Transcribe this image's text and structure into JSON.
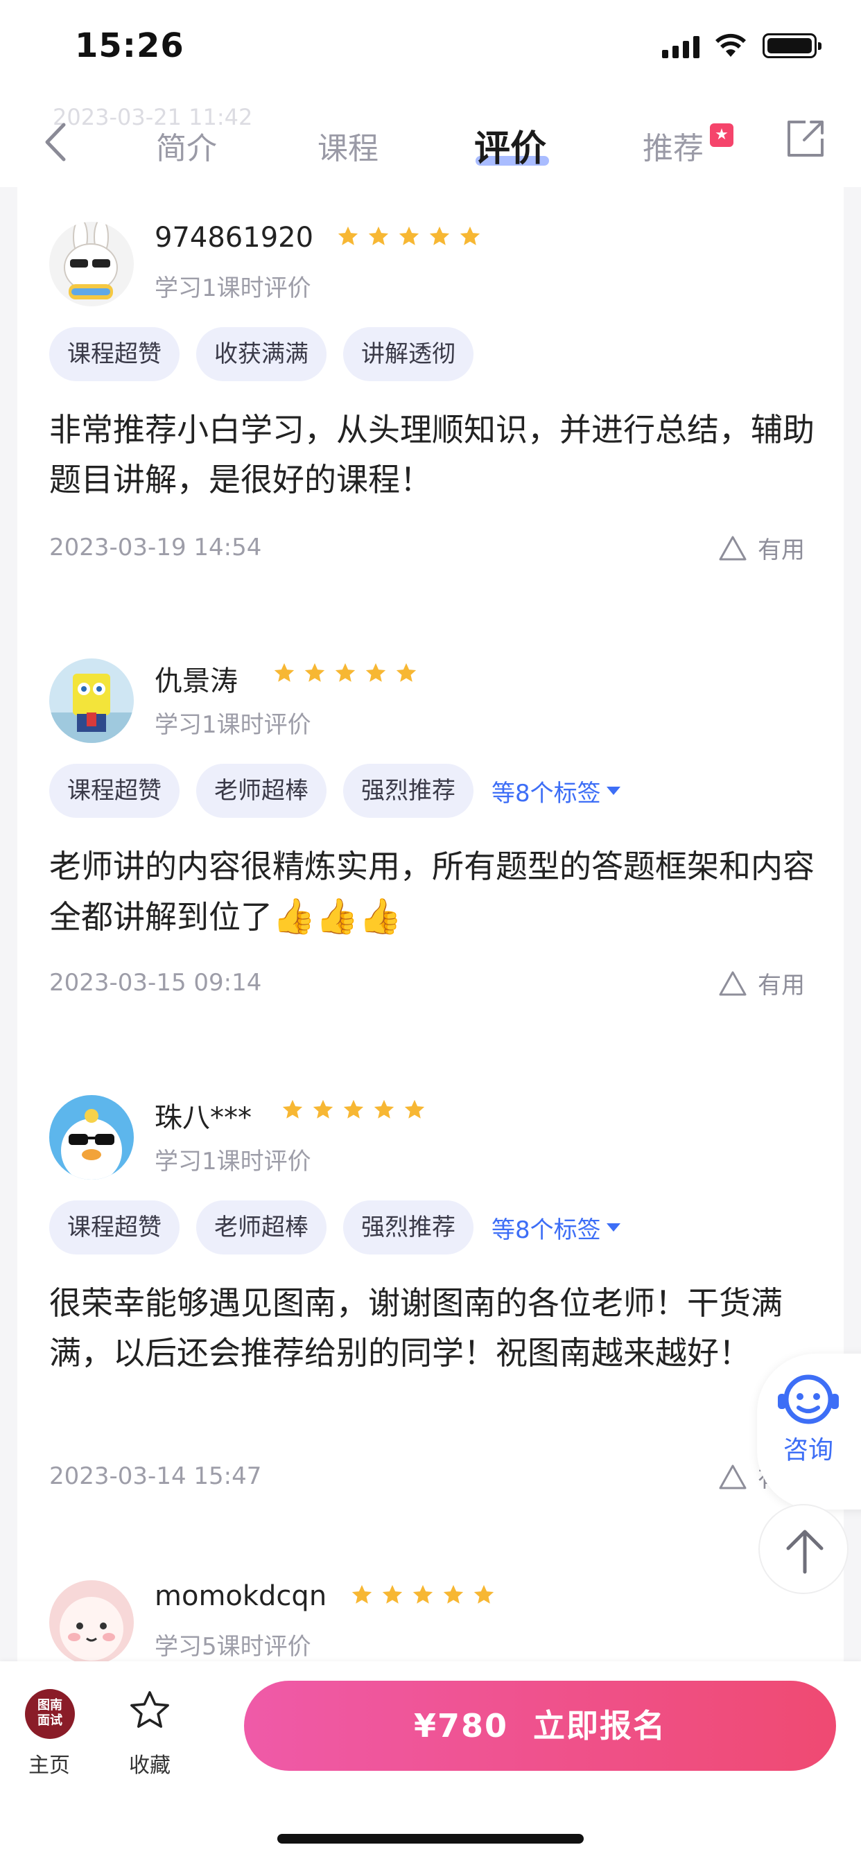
{
  "status_bar": {
    "time": "15:26"
  },
  "nav": {
    "faded_date": "2023-03-21 11:42",
    "tabs": [
      {
        "label": "简介",
        "active": false
      },
      {
        "label": "课程",
        "active": false
      },
      {
        "label": "评价",
        "active": true
      },
      {
        "label": "推荐",
        "active": false
      }
    ],
    "recommend_badge": "★"
  },
  "reviews": [
    {
      "username": "974861920",
      "rating": 5,
      "meta": "学习1课时评价",
      "tags": [
        "课程超赞",
        "收获满满",
        "讲解透彻"
      ],
      "more_tags": "",
      "text": "非常推荐小白学习，从头理顺知识，并进行总结，辅助题目讲解，是很好的课程！",
      "date": "2023-03-19 14:54",
      "useful_label": "有用"
    },
    {
      "username": "仇景涛",
      "rating": 5,
      "meta": "学习1课时评价",
      "tags": [
        "课程超赞",
        "老师超棒",
        "强烈推荐"
      ],
      "more_tags": "等8个标签",
      "text": "老师讲的内容很精炼实用，所有题型的答题框架和内容全都讲解到位了",
      "emoji": "👍👍👍",
      "date": "2023-03-15 09:14",
      "useful_label": "有用"
    },
    {
      "username": "珠八***",
      "rating": 5,
      "meta": "学习1课时评价",
      "tags": [
        "课程超赞",
        "老师超棒",
        "强烈推荐"
      ],
      "more_tags": "等8个标签",
      "text": "很荣幸能够遇见图南，谢谢图南的各位老师！干货满满，以后还会推荐给别的同学！祝图南越来越好！",
      "date": "2023-03-14 15:47",
      "useful_label": "有用"
    },
    {
      "username": "momokdcqn",
      "rating": 5,
      "meta": "学习5课时评价"
    }
  ],
  "float": {
    "consult_label": "咨询"
  },
  "bottom_bar": {
    "home_logo": "图南\n面试",
    "home_label": "主页",
    "favorite_label": "收藏",
    "buy_label": "¥780  立即报名"
  },
  "colors": {
    "accent": "#3d6ef6",
    "star": "#f7b733",
    "buy_start": "#ef5aa8",
    "buy_end": "#ef4a72"
  }
}
